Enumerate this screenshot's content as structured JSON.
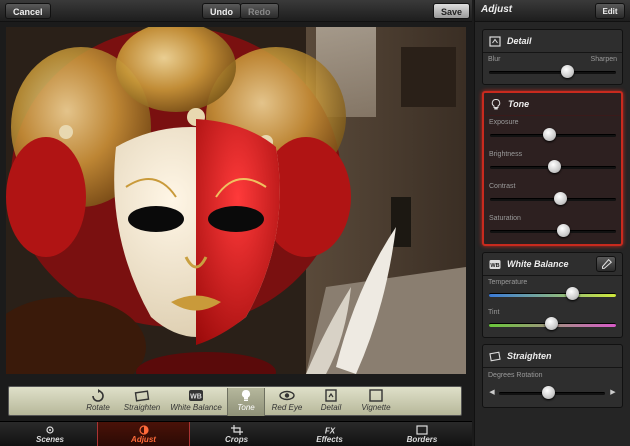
{
  "toolbar": {
    "cancel_label": "Cancel",
    "undo_label": "Undo",
    "redo_label": "Redo",
    "save_label": "Save"
  },
  "tools": [
    {
      "label": "Rotate",
      "icon": "rotate-icon"
    },
    {
      "label": "Straighten",
      "icon": "straighten-icon"
    },
    {
      "label": "White Balance",
      "icon": "white-balance-icon"
    },
    {
      "label": "Tone",
      "icon": "tone-icon",
      "active": true
    },
    {
      "label": "Red Eye",
      "icon": "red-eye-icon"
    },
    {
      "label": "Detail",
      "icon": "detail-icon"
    },
    {
      "label": "Vignette",
      "icon": "vignette-icon"
    }
  ],
  "nav": [
    {
      "label": "Scenes",
      "icon": "scenes-icon"
    },
    {
      "label": "Adjust",
      "icon": "adjust-icon",
      "active": true
    },
    {
      "label": "Crops",
      "icon": "crops-icon"
    },
    {
      "label": "Effects",
      "icon": "effects-icon"
    },
    {
      "label": "Borders",
      "icon": "borders-icon"
    }
  ],
  "panel": {
    "title": "Adjust",
    "edit_label": "Edit",
    "detail": {
      "title": "Detail",
      "left_label": "Blur",
      "right_label": "Sharpen",
      "value": 0.62
    },
    "tone": {
      "title": "Tone",
      "sliders": [
        {
          "label": "Exposure",
          "value": 0.47
        },
        {
          "label": "Brightness",
          "value": 0.51
        },
        {
          "label": "Contrast",
          "value": 0.56
        },
        {
          "label": "Saturation",
          "value": 0.58
        }
      ]
    },
    "white_balance": {
      "title": "White Balance",
      "sliders": [
        {
          "label": "Temperature",
          "value": 0.66
        },
        {
          "label": "Tint",
          "value": 0.49
        }
      ]
    },
    "straighten": {
      "title": "Straighten",
      "label": "Degrees Rotation",
      "value": 0.47
    }
  },
  "colors": {
    "accent": "#c92a1e",
    "active_nav_text": "#ff6a3a",
    "tool_strip": "#cfd0b4"
  }
}
